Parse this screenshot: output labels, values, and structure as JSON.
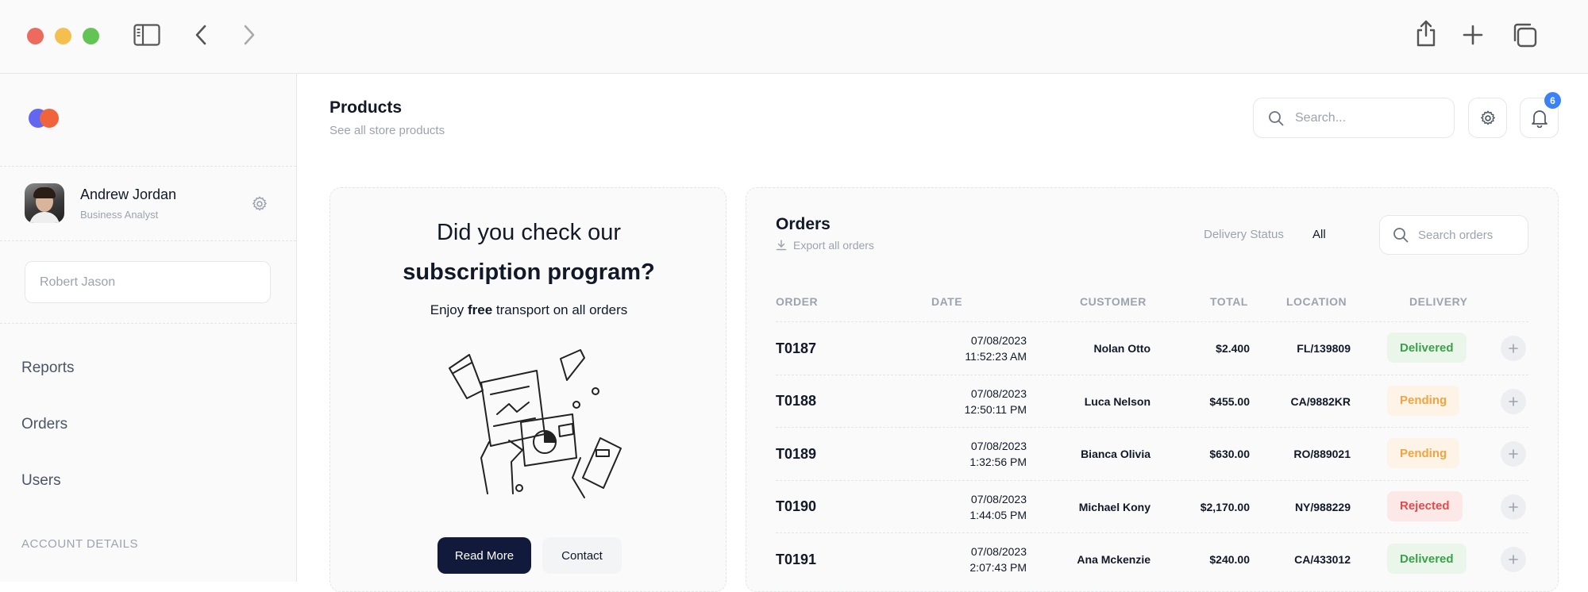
{
  "window": {
    "icons": [
      "sidebar-toggle-icon",
      "back-icon",
      "forward-icon",
      "share-icon",
      "new-tab-icon",
      "tabs-overview-icon"
    ]
  },
  "sidebar": {
    "user": {
      "name": "Andrew Jordan",
      "role": "Business Analyst"
    },
    "field_value": "Robert Jason",
    "nav": [
      {
        "label": "Reports"
      },
      {
        "label": "Orders"
      },
      {
        "label": "Users"
      }
    ],
    "section_label": "ACCOUNT DETAILS"
  },
  "header": {
    "title": "Products",
    "subtitle": "See all store products",
    "search_placeholder": "Search...",
    "notification_count": "6"
  },
  "promo": {
    "line1": "Did you check our",
    "line2": "subscription program?",
    "line3_pre": "Enjoy ",
    "line3_bold": "free",
    "line3_post": " transport on all orders",
    "primary_button": "Read More",
    "secondary_button": "Contact"
  },
  "orders": {
    "title": "Orders",
    "export_label": "Export all orders",
    "filter_label": "Delivery Status",
    "filter_value": "All",
    "search_placeholder": "Search orders",
    "columns": [
      "ORDER",
      "DATE",
      "CUSTOMER",
      "TOTAL",
      "LOCATION",
      "DELIVERY"
    ],
    "rows": [
      {
        "order": "T0187",
        "date": "07/08/2023",
        "time": "11:52:23 AM",
        "customer": "Nolan Otto",
        "total": "$2.400",
        "location": "FL/139809",
        "status": "Delivered"
      },
      {
        "order": "T0188",
        "date": "07/08/2023",
        "time": "12:50:11 PM",
        "customer": "Luca Nelson",
        "total": "$455.00",
        "location": "CA/9882KR",
        "status": "Pending"
      },
      {
        "order": "T0189",
        "date": "07/08/2023",
        "time": "1:32:56 PM",
        "customer": "Bianca Olivia",
        "total": "$630.00",
        "location": "RO/889021",
        "status": "Pending"
      },
      {
        "order": "T0190",
        "date": "07/08/2023",
        "time": "1:44:05 PM",
        "customer": "Michael Kony",
        "total": "$2,170.00",
        "location": "NY/988229",
        "status": "Rejected"
      },
      {
        "order": "T0191",
        "date": "07/08/2023",
        "time": "2:07:43 PM",
        "customer": "Ana Mckenzie",
        "total": "$240.00",
        "location": "CA/433012",
        "status": "Delivered"
      }
    ]
  },
  "colors": {
    "delivered": "#3aa14a",
    "pending": "#f0a540",
    "rejected": "#e24b4b",
    "primary_button": "#111a3a",
    "badge": "#3b82f6"
  }
}
